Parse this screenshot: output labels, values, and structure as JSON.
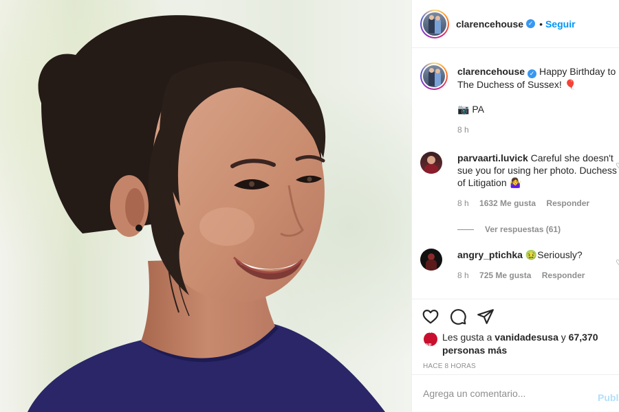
{
  "post": {
    "author": "clarencehouse",
    "follow_label": "Seguir",
    "dot": "•",
    "caption_text": "Happy Birthday to The Duchess of Sussex! 🎈",
    "credit": "📷 PA",
    "caption_time": "8 h"
  },
  "comments": [
    {
      "username": "parvaarti.luvick",
      "text": "Careful she doesn't sue you for using her photo. Duchess of Litigation 🤷‍♀️",
      "time": "8 h",
      "likes": "1632 Me gusta",
      "reply_label": "Responder",
      "view_replies": "Ver respuestas (61)"
    },
    {
      "username": "angry_ptichka",
      "text": "🤢Seriously?",
      "time": "8 h",
      "likes": "725 Me gusta",
      "reply_label": "Responder"
    }
  ],
  "actions": {
    "like_icon": "heart-icon",
    "comment_icon": "comment-icon",
    "share_icon": "share-icon"
  },
  "likes_summary": {
    "prefix": "Les gusta a ",
    "first_user": "vanidadesusa",
    "middle": " y ",
    "others": "67,370 personas más",
    "badge_text": "VANITY FAIR"
  },
  "timestamp": "HACE 8 HORAS",
  "composer": {
    "placeholder": "Agrega un comentario...",
    "publish_label": "Publicar"
  },
  "colors": {
    "link_blue": "#0095f6",
    "verified_blue": "#3897f0",
    "muted": "#8e8e8e",
    "text": "#262626"
  }
}
